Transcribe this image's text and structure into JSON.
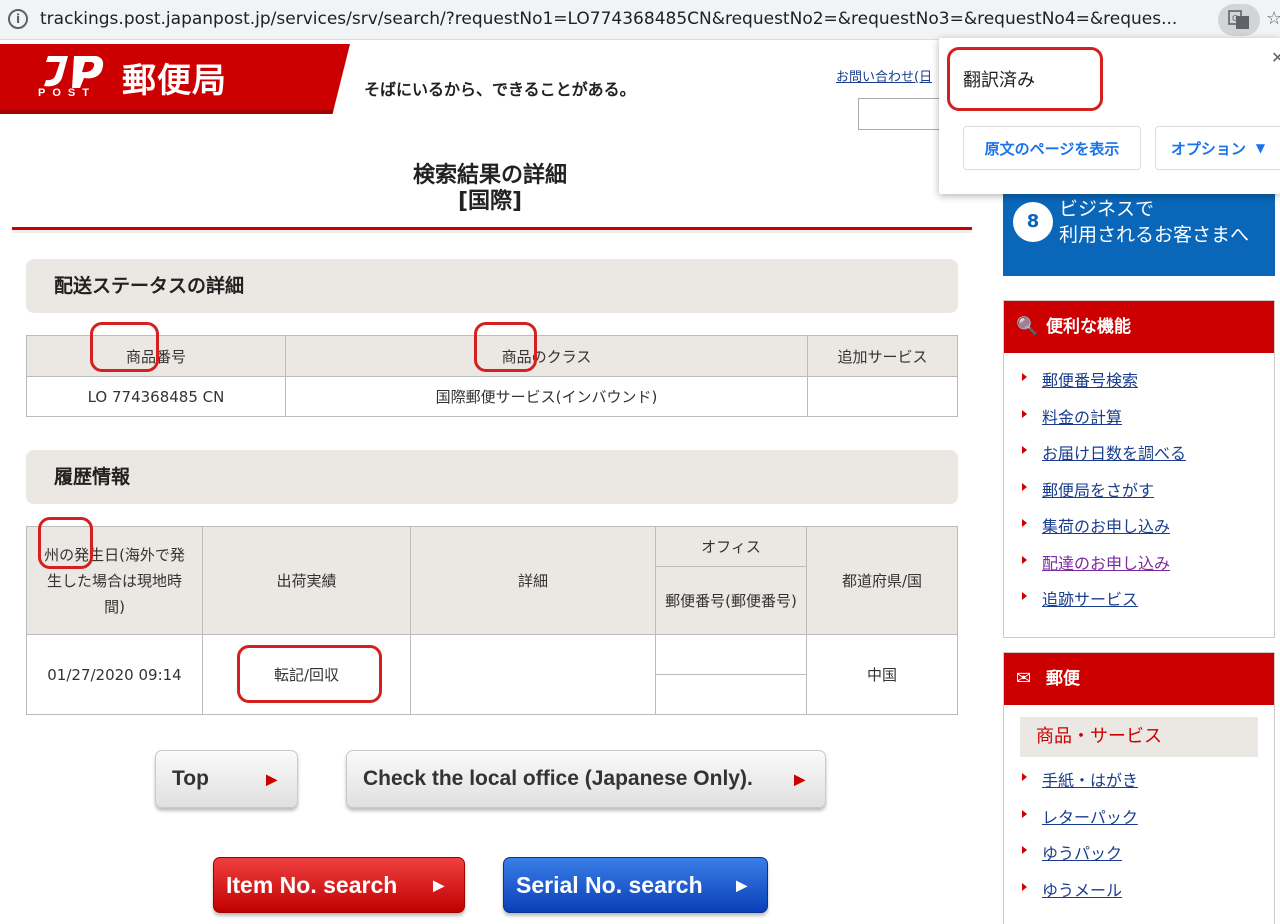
{
  "browser": {
    "url": "trackings.post.japanpost.jp/services/srv/search/?requestNo1=LO774368485CN&requestNo2=&requestNo3=&requestNo4=&reques..."
  },
  "header": {
    "logo_text": "郵便局",
    "logo_sub": "POST",
    "tagline": "そばにいるから、できることがある。",
    "contact_link": "お問い合わせ(日"
  },
  "translate_popup": {
    "title": "翻訳済み",
    "show_original": "原文のページを表示",
    "options": "オプション"
  },
  "page": {
    "title": "検索結果の詳細",
    "subtitle": "[国際]"
  },
  "delivery": {
    "section_title": "配送ステータスの詳細",
    "headers": [
      "商品番号",
      "商品のクラス",
      "追加サービス"
    ],
    "row": [
      "LO 774368485 CN",
      "国際郵便サービス(インバウンド)",
      ""
    ]
  },
  "history": {
    "section_title": "履歴情報",
    "headers": {
      "date": "州の発生日(海外で発生した場合は現地時間)",
      "shipment": "出荷実績",
      "detail": "詳細",
      "office": "オフィス",
      "postal_code": "郵便番号(郵便番号)",
      "prefecture": "都道府県/国"
    },
    "row": {
      "date": "01/27/2020 09:14",
      "shipment": "転記/回収",
      "detail": "",
      "office": "",
      "postal_code": "",
      "prefecture": "中国"
    }
  },
  "buttons": {
    "top": "Top",
    "local_office": "Check the local office (Japanese Only).",
    "item_search": "Item No. search",
    "serial_search": "Serial No. search"
  },
  "sidebar": {
    "business": "ビジネスで\n利用されるお客さまへ",
    "useful_title": "便利な機能",
    "useful_items": [
      "郵便番号検索",
      "料金の計算",
      "お届け日数を調べる",
      "郵便局をさがす",
      "集荷のお申し込み",
      "配達のお申し込み",
      "追跡サービス"
    ],
    "mail_title": "郵便",
    "mail_subtitle": "商品・サービス",
    "mail_items": [
      "手紙・はがき",
      "レターパック",
      "ゆうパック",
      "ゆうメール"
    ]
  },
  "colors": {
    "brand_red": "#cc0000",
    "business_blue": "#0a66b8",
    "annotation_red": "#d4201f"
  }
}
